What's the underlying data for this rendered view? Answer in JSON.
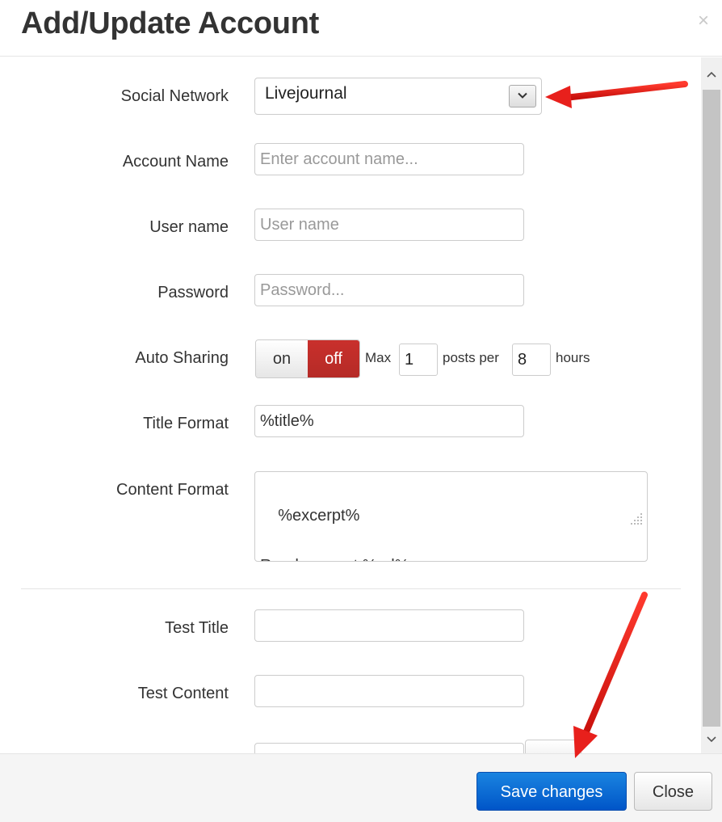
{
  "modal": {
    "title": "Add/Update Account",
    "close_glyph": "×"
  },
  "form": {
    "social_network": {
      "label": "Social Network",
      "value": "Livejournal"
    },
    "account_name": {
      "label": "Account Name",
      "placeholder": "Enter account name...",
      "value": ""
    },
    "user_name": {
      "label": "User name",
      "placeholder": "User name",
      "value": ""
    },
    "password": {
      "label": "Password",
      "placeholder": "Password...",
      "value": ""
    },
    "auto_sharing": {
      "label": "Auto Sharing",
      "on_label": "on",
      "off_label": "off",
      "selected": "off",
      "max_label": "Max",
      "max_value": "1",
      "posts_per_label": "posts per",
      "hours_value": "8",
      "hours_label": "hours"
    },
    "title_format": {
      "label": "Title Format",
      "value": "%title%"
    },
    "content_format": {
      "label": "Content Format",
      "value": "%excerpt%\n\nRead more at %url%"
    },
    "test_title": {
      "label": "Test Title",
      "value": ""
    },
    "test_content": {
      "label": "Test Content",
      "value": ""
    }
  },
  "footer": {
    "save_label": "Save changes",
    "close_label": "Close"
  },
  "colors": {
    "primary_button": "#0a6ad8",
    "toggle_off_active": "#c0392b",
    "annotation_arrow": "#e8201c"
  }
}
